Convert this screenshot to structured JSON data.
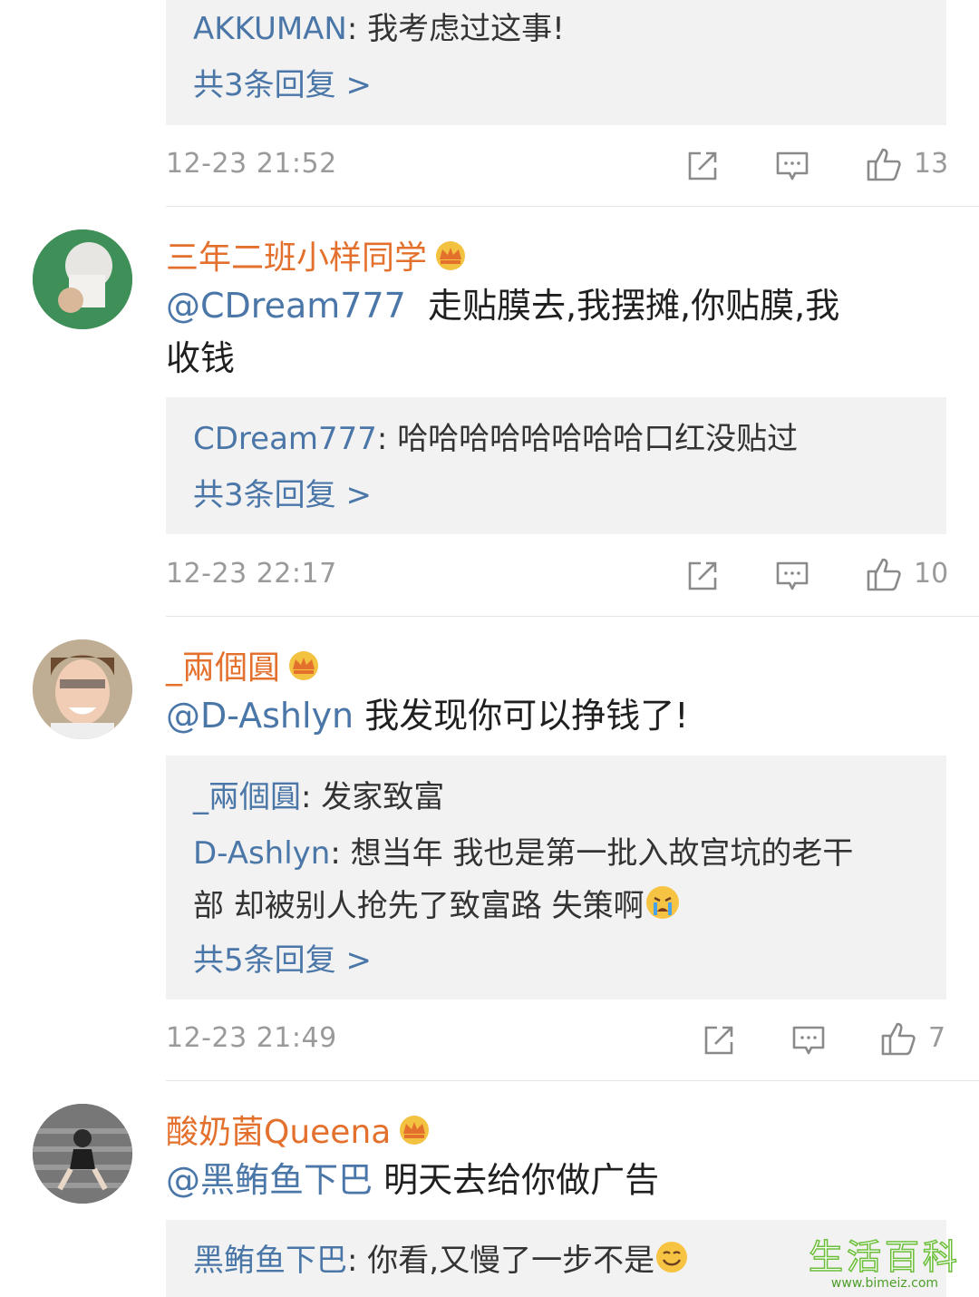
{
  "comments": [
    {
      "replies": [
        {
          "user": "AKKUMAN",
          "text": "我考虑过这事!"
        }
      ],
      "more": "共3条回复 >",
      "time": "12-23 21:52",
      "likes": "13"
    },
    {
      "username": "三年二班小样同学",
      "mention": "@CDream777",
      "text_line1": "走贴膜去,我摆摊,你贴膜,我",
      "text_line2": "收钱",
      "replies": [
        {
          "user": "CDream777",
          "text": "哈哈哈哈哈哈哈哈口红没贴过"
        }
      ],
      "more": "共3条回复 >",
      "time": "12-23 22:17",
      "likes": "10"
    },
    {
      "username": "_兩個圓",
      "mention": "@D-Ashlyn",
      "text_line1": "我发现你可以挣钱了!",
      "replies": [
        {
          "user": "_兩個圓",
          "text": "发家致富"
        },
        {
          "user": "D-Ashlyn",
          "text": "想当年 我也是第一批入故宫坑的老干"
        },
        {
          "text": "部 却被别人抢先了致富路 失策啊"
        }
      ],
      "more": "共5条回复 >",
      "time": "12-23 21:49",
      "likes": "7"
    },
    {
      "username": "酸奶菌Queena",
      "mention": "@黑鲔鱼下巴",
      "text_line1": "明天去给你做广告",
      "replies": [
        {
          "user": "黑鲔鱼下巴",
          "text": "你看,又慢了一步不是"
        }
      ]
    }
  ],
  "watermark": {
    "title": "生活百科",
    "url": "www.bimeiz.com"
  },
  "colors": {
    "link": "#4a76a8",
    "username": "#e4702d",
    "meta": "#9a9a9a",
    "reply_bg": "#f2f2f2"
  }
}
